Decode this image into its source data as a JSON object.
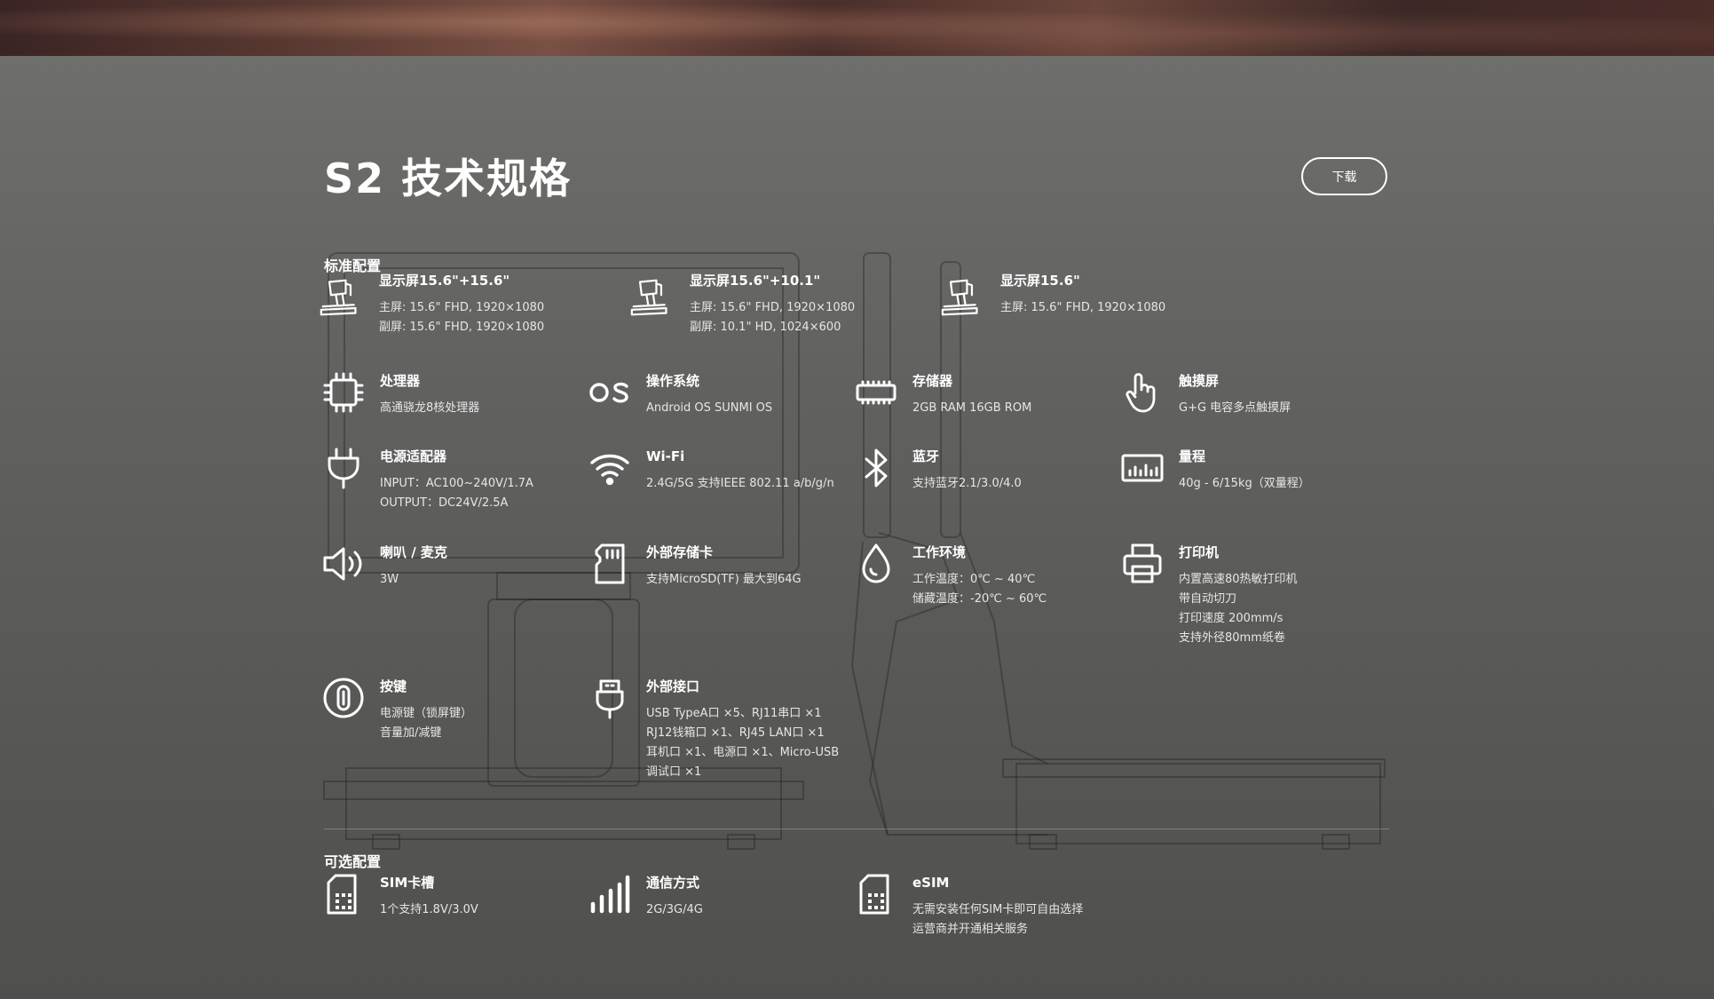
{
  "page": {
    "title": "S2 技术规格",
    "download_label": "下载"
  },
  "standard": {
    "section_title": "标准配置",
    "displays": [
      {
        "icon": "monitor-stand-icon",
        "title": "显示屏15.6\"+15.6\"",
        "lines": [
          "主屏: 15.6\" FHD, 1920×1080",
          "副屏: 15.6\" FHD, 1920×1080"
        ]
      },
      {
        "icon": "monitor-stand-icon",
        "title": "显示屏15.6\"+10.1\"",
        "lines": [
          "主屏: 15.6\" FHD, 1920×1080",
          "副屏: 10.1\" HD, 1024×600"
        ]
      },
      {
        "icon": "monitor-stand-icon",
        "title": "显示屏15.6\"",
        "lines": [
          "主屏: 15.6\" FHD, 1920×1080"
        ]
      }
    ],
    "specs": [
      {
        "icon": "cpu-chip-icon",
        "title": "处理器",
        "lines": [
          "高通骁龙8核处理器"
        ]
      },
      {
        "icon": "os-icon",
        "title": "操作系统",
        "lines": [
          "Android OS SUNMI OS"
        ]
      },
      {
        "icon": "memory-icon",
        "title": "存储器",
        "lines": [
          "2GB RAM 16GB ROM"
        ]
      },
      {
        "icon": "touch-hand-icon",
        "title": "触摸屏",
        "lines": [
          "G+G 电容多点触摸屏"
        ]
      },
      {
        "icon": "power-plug-icon",
        "title": "电源适配器",
        "lines": [
          "INPUT：AC100~240V/1.7A",
          "OUTPUT：DC24V/2.5A"
        ]
      },
      {
        "icon": "wifi-icon",
        "title": "Wi-Fi",
        "lines": [
          "2.4G/5G 支持IEEE 802.11 a/b/g/n"
        ]
      },
      {
        "icon": "bluetooth-icon",
        "title": "蓝牙",
        "lines": [
          "支持蓝牙2.1/3.0/4.0"
        ]
      },
      {
        "icon": "scale-icon",
        "title": "量程",
        "lines": [
          "40g - 6/15kg（双量程）"
        ]
      },
      {
        "icon": "speaker-icon",
        "title": "喇叭 / 麦克",
        "lines": [
          "3W"
        ]
      },
      {
        "icon": "sd-card-icon",
        "title": "外部存储卡",
        "lines": [
          "支持MicroSD(TF) 最大到64G"
        ]
      },
      {
        "icon": "water-drop-icon",
        "title": "工作环境",
        "lines": [
          "工作温度：0℃ ~ 40℃",
          "储藏温度：-20℃ ~ 60℃"
        ]
      },
      {
        "icon": "printer-icon",
        "title": "打印机",
        "lines": [
          "内置高速80热敏打印机",
          "带自动切刀",
          "打印速度 200mm/s",
          "支持外径80mm纸卷"
        ]
      },
      {
        "icon": "button-key-icon",
        "title": "按键",
        "lines": [
          "电源键（锁屏键）",
          "音量加/减键"
        ]
      },
      {
        "icon": "usb-port-icon",
        "title": "外部接口",
        "lines": [
          "USB TypeA口 ×5、RJ11串口 ×1",
          "RJ12钱箱口 ×1、RJ45 LAN口 ×1",
          "耳机口 ×1、电源口 ×1、Micro-USB",
          "调试口 ×1"
        ]
      }
    ]
  },
  "optional": {
    "section_title": "可选配置",
    "specs": [
      {
        "icon": "sim-card-icon",
        "title": "SIM卡槽",
        "lines": [
          "1个支持1.8V/3.0V"
        ]
      },
      {
        "icon": "signal-bars-icon",
        "title": "通信方式",
        "lines": [
          "2G/3G/4G"
        ]
      },
      {
        "icon": "esim-icon",
        "title": "eSIM",
        "lines": [
          "无需安装任何SIM卡即可自由选择",
          "运营商并开通相关服务"
        ]
      }
    ]
  }
}
